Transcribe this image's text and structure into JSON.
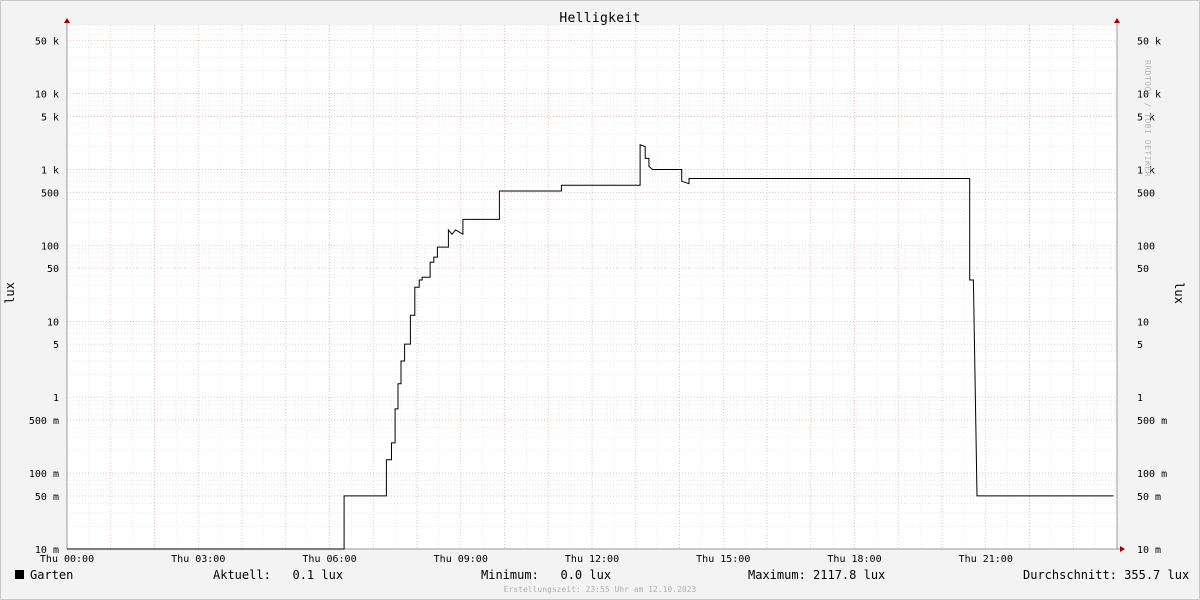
{
  "chart_data": {
    "type": "line",
    "title": "Helligkeit",
    "ylabel": "lux",
    "scale": "log",
    "ylim": [
      0.01,
      80000
    ],
    "grid": true,
    "watermark": "RRDTOOL / TOBI OETIKER",
    "x_ticks": [
      "Thu 00:00",
      "Thu 03:00",
      "Thu 06:00",
      "Thu 09:00",
      "Thu 12:00",
      "Thu 15:00",
      "Thu 18:00",
      "Thu 21:00"
    ],
    "y_ticks": [
      {
        "value": 0.01,
        "label": "10 m"
      },
      {
        "value": 0.05,
        "label": "50 m"
      },
      {
        "value": 0.1,
        "label": "100 m"
      },
      {
        "value": 0.5,
        "label": "500 m"
      },
      {
        "value": 1,
        "label": "1"
      },
      {
        "value": 5,
        "label": "5"
      },
      {
        "value": 10,
        "label": "10"
      },
      {
        "value": 50,
        "label": "50"
      },
      {
        "value": 100,
        "label": "100"
      },
      {
        "value": 500,
        "label": "500"
      },
      {
        "value": 1000,
        "label": "1 k"
      },
      {
        "value": 5000,
        "label": "5 k"
      },
      {
        "value": 10000,
        "label": "10 k"
      },
      {
        "value": 50000,
        "label": "50 k"
      }
    ],
    "series": [
      {
        "name": "Garten",
        "color": "#000000",
        "points": [
          [
            "00:00",
            0.01
          ],
          [
            "06:20",
            0.01
          ],
          [
            "06:20",
            0.05
          ],
          [
            "07:18",
            0.05
          ],
          [
            "07:18",
            0.15
          ],
          [
            "07:25",
            0.15
          ],
          [
            "07:25",
            0.25
          ],
          [
            "07:30",
            0.25
          ],
          [
            "07:30",
            0.7
          ],
          [
            "07:34",
            0.7
          ],
          [
            "07:34",
            1.5
          ],
          [
            "07:38",
            1.5
          ],
          [
            "07:38",
            3
          ],
          [
            "07:43",
            3
          ],
          [
            "07:43",
            5
          ],
          [
            "07:51",
            5
          ],
          [
            "07:51",
            12
          ],
          [
            "07:57",
            12
          ],
          [
            "07:57",
            28
          ],
          [
            "08:03",
            28
          ],
          [
            "08:03",
            35
          ],
          [
            "08:07",
            35
          ],
          [
            "08:07",
            38
          ],
          [
            "08:18",
            38
          ],
          [
            "08:18",
            60
          ],
          [
            "08:23",
            60
          ],
          [
            "08:23",
            70
          ],
          [
            "08:28",
            70
          ],
          [
            "08:28",
            95
          ],
          [
            "08:43",
            95
          ],
          [
            "08:43",
            160
          ],
          [
            "08:48",
            140
          ],
          [
            "08:53",
            160
          ],
          [
            "09:03",
            140
          ],
          [
            "09:03",
            220
          ],
          [
            "09:53",
            220
          ],
          [
            "09:53",
            520
          ],
          [
            "11:18",
            520
          ],
          [
            "11:18",
            620
          ],
          [
            "13:06",
            620
          ],
          [
            "13:06",
            2117.8
          ],
          [
            "13:13",
            2000
          ],
          [
            "13:13",
            1400
          ],
          [
            "13:18",
            1400
          ],
          [
            "13:18",
            1100
          ],
          [
            "13:23",
            1000
          ],
          [
            "14:03",
            1000
          ],
          [
            "14:03",
            700
          ],
          [
            "14:13",
            650
          ],
          [
            "14:13",
            760
          ],
          [
            "20:38",
            760
          ],
          [
            "20:38",
            35
          ],
          [
            "20:43",
            35
          ],
          [
            "20:48",
            0.05
          ],
          [
            "23:55",
            0.05
          ]
        ]
      }
    ]
  },
  "legend": {
    "series_name": "Garten",
    "aktuell": "Aktuell:   0.1 lux",
    "minimum": "Minimum:   0.0 lux",
    "maximum": "Maximum: 2117.8 lux",
    "durchschnitt": "Durchschnitt: 355.7 lux"
  },
  "footer": "Erstellungszeit: 23:55 Uhr am 12.10.2023"
}
